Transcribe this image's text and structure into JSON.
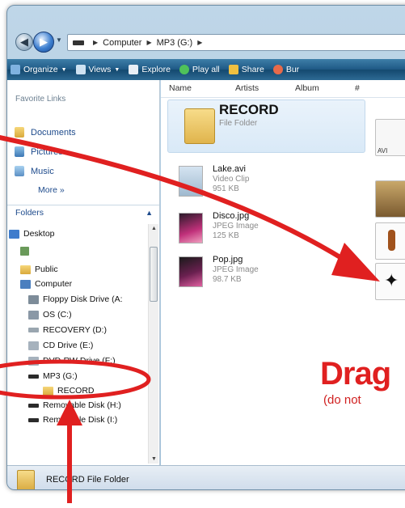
{
  "address_bar": {
    "crumbs": [
      "Computer",
      "MP3 (G:)"
    ]
  },
  "toolbar": {
    "items": [
      "Organize",
      "Views",
      "Explore",
      "Play all",
      "Share",
      "Bur"
    ]
  },
  "nav_pane": {
    "favorites_header": "Favorite Links",
    "favorites": [
      "Documents",
      "Pictures",
      "Music"
    ],
    "more_label": "More »",
    "folders_header": "Folders",
    "tree": [
      "Desktop",
      "Public",
      "Computer",
      "Floppy Disk Drive (A:",
      "OS (C:)",
      "RECOVERY (D:)",
      "CD Drive (E:)",
      "DVD-RW Drive (F:)",
      "MP3 (G:)",
      "RECORD",
      "Removable Disk (H:)",
      "Removable Disk (I:)"
    ]
  },
  "content": {
    "columns": [
      "Name",
      "Artists",
      "Album",
      "#"
    ],
    "selected": {
      "name": "RECORD",
      "type": "File Folder"
    },
    "files": [
      {
        "name": "Lake.avi",
        "type": "Video Clip",
        "size": "951 KB"
      },
      {
        "name": "Disco.jpg",
        "type": "JPEG Image",
        "size": "125 KB"
      },
      {
        "name": "Pop.jpg",
        "type": "JPEG Image",
        "size": "98.7 KB"
      }
    ],
    "right_thumb_label": "AVI"
  },
  "details_pane": {
    "text": "RECORD File Folder"
  },
  "annotations": {
    "drag_text": "Drag",
    "drag_note": "(do not"
  },
  "colors": {
    "annotation_red": "#e02020",
    "toolbar_blue": "#1f5a86"
  }
}
